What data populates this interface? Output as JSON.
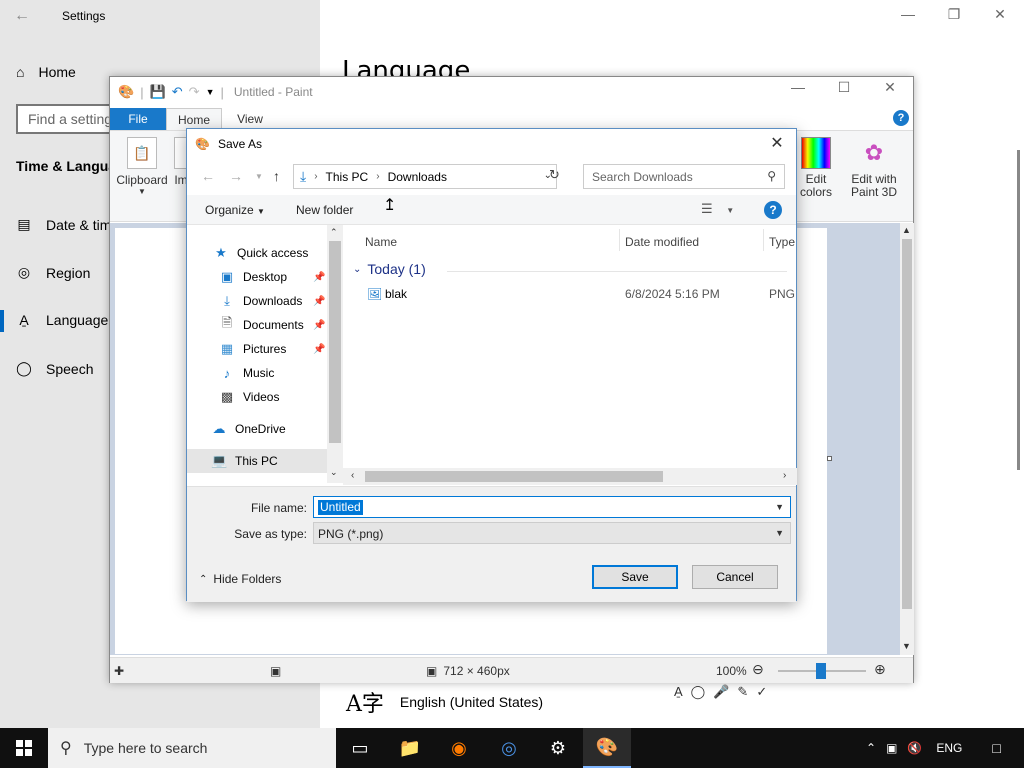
{
  "settings": {
    "title": "Settings",
    "home_label": "Home",
    "search_placeholder": "Find a setting",
    "section": "Time & Language",
    "nav": [
      {
        "label": "Date & time",
        "icon": "date-time-icon"
      },
      {
        "label": "Region",
        "icon": "globe-icon"
      },
      {
        "label": "Language",
        "icon": "language-icon"
      },
      {
        "label": "Speech",
        "icon": "microphone-icon"
      }
    ],
    "active_nav": "Language",
    "page_heading": "Language",
    "language_item": "English (United States)"
  },
  "paint": {
    "title": "Untitled - Paint",
    "tabs": [
      "File",
      "Home",
      "View"
    ],
    "active_tab": "Home",
    "ribbon": {
      "clipboard": "Clipboard",
      "image_partial": "Im",
      "edit_colors": "Edit colors",
      "edit_paint3d": "Edit with Paint 3D"
    },
    "status": {
      "dimensions": "712 × 460px",
      "zoom": "100%",
      "zoom_fraction": 0.5
    }
  },
  "dialog": {
    "title": "Save As",
    "path": [
      "This PC",
      "Downloads"
    ],
    "search_placeholder": "Search Downloads",
    "organize": "Organize",
    "new_folder": "New folder",
    "nav_items": [
      {
        "label": "Quick access",
        "icon": "star-icon",
        "pinned": false
      },
      {
        "label": "Desktop",
        "icon": "desktop-folder-icon",
        "pinned": true
      },
      {
        "label": "Downloads",
        "icon": "download-icon",
        "pinned": true
      },
      {
        "label": "Documents",
        "icon": "documents-icon",
        "pinned": true
      },
      {
        "label": "Pictures",
        "icon": "pictures-icon",
        "pinned": true
      },
      {
        "label": "Music",
        "icon": "music-icon",
        "pinned": false
      },
      {
        "label": "Videos",
        "icon": "videos-icon",
        "pinned": false
      },
      {
        "label": "OneDrive",
        "icon": "cloud-icon",
        "pinned": false
      },
      {
        "label": "This PC",
        "icon": "computer-icon",
        "pinned": false
      }
    ],
    "selected_nav": "This PC",
    "columns": [
      "Name",
      "Date modified",
      "Type"
    ],
    "group": "Today (1)",
    "files": [
      {
        "name": "blak",
        "date": "6/8/2024 5:16 PM",
        "type": "PNG"
      }
    ],
    "file_name_label": "File name:",
    "file_name_value": "Untitled",
    "save_type_label": "Save as type:",
    "save_type_value": "PNG (*.png)",
    "hide_folders": "Hide Folders",
    "save": "Save",
    "cancel": "Cancel"
  },
  "taskbar": {
    "search_placeholder": "Type here to search",
    "apps": [
      "task-view-icon",
      "file-explorer-icon",
      "firefox-icon",
      "chrome-icon",
      "settings-icon",
      "paint-icon"
    ],
    "active_app": "paint-icon",
    "language": "ENG"
  },
  "colors": {
    "accent": "#0078d7",
    "paint_file_tab": "#1979ca",
    "taskbar": "#101010"
  }
}
